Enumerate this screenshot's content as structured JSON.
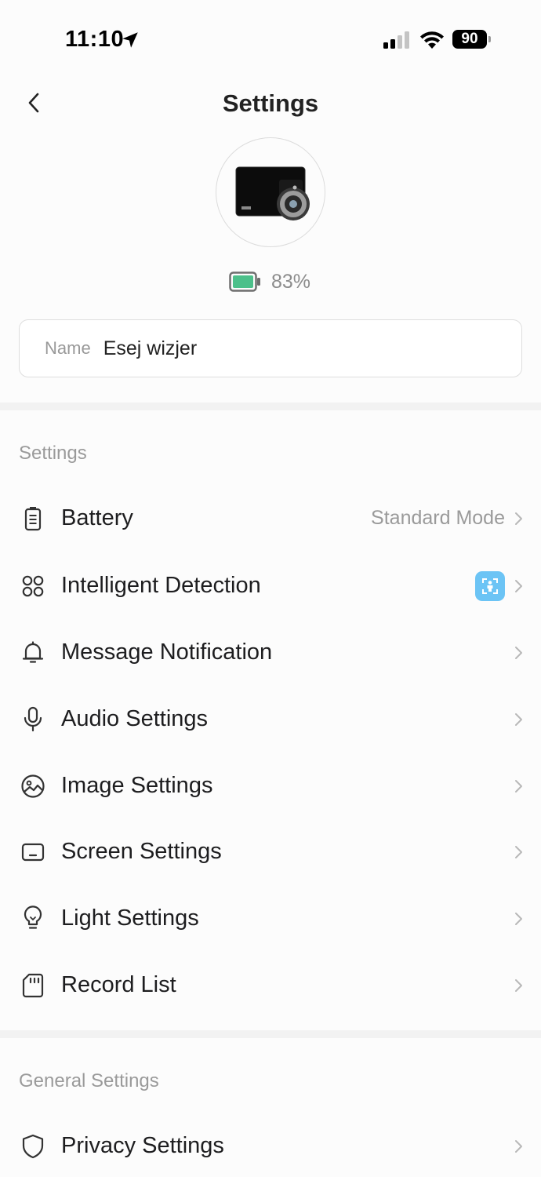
{
  "status_bar": {
    "time": "11:10",
    "battery_level": "90"
  },
  "header": {
    "title": "Settings"
  },
  "device": {
    "battery_percent": "83%",
    "battery_color": "#4cc08a"
  },
  "name_field": {
    "label": "Name",
    "value": "Esej wizjer"
  },
  "sections": {
    "settings": {
      "title": "Settings",
      "items": [
        {
          "label": "Battery",
          "value": "Standard Mode",
          "icon": "battery-icon"
        },
        {
          "label": "Intelligent Detection",
          "icon": "grid-icon",
          "badge_icon": "person-detect-icon"
        },
        {
          "label": "Message Notification",
          "icon": "bell-icon"
        },
        {
          "label": "Audio Settings",
          "icon": "microphone-icon"
        },
        {
          "label": "Image Settings",
          "icon": "image-icon"
        },
        {
          "label": "Screen Settings",
          "icon": "screen-icon"
        },
        {
          "label": "Light Settings",
          "icon": "lightbulb-icon"
        },
        {
          "label": "Record List",
          "icon": "sd-card-icon"
        }
      ]
    },
    "general": {
      "title": "General Settings",
      "items": [
        {
          "label": "Privacy Settings",
          "icon": "shield-icon"
        }
      ]
    }
  },
  "colors": {
    "accent_badge": "#6cc4f5",
    "chevron": "#b8b8b8"
  }
}
